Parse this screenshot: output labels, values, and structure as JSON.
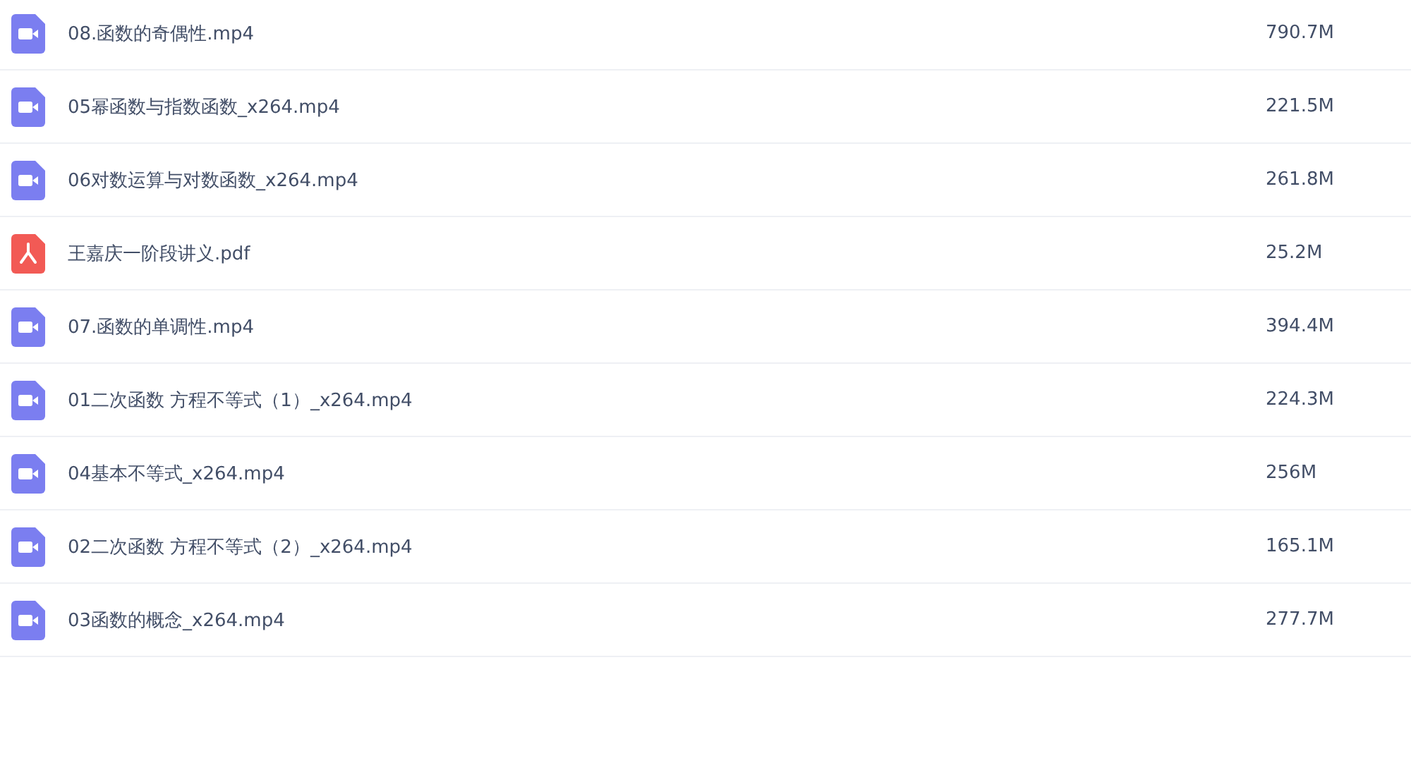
{
  "files": [
    {
      "kind": "video",
      "name": "08.函数的奇偶性.mp4",
      "size": "790.7M"
    },
    {
      "kind": "video",
      "name": "05幂函数与指数函数_x264.mp4",
      "size": "221.5M"
    },
    {
      "kind": "video",
      "name": "06对数运算与对数函数_x264.mp4",
      "size": "261.8M"
    },
    {
      "kind": "pdf",
      "name": "王嘉庆一阶段讲义.pdf",
      "size": "25.2M"
    },
    {
      "kind": "video",
      "name": "07.函数的单调性.mp4",
      "size": "394.4M"
    },
    {
      "kind": "video",
      "name": "01二次函数 方程不等式（1）_x264.mp4",
      "size": "224.3M"
    },
    {
      "kind": "video",
      "name": "04基本不等式_x264.mp4",
      "size": "256M"
    },
    {
      "kind": "video",
      "name": "02二次函数 方程不等式（2）_x264.mp4",
      "size": "165.1M"
    },
    {
      "kind": "video",
      "name": "03函数的概念_x264.mp4",
      "size": "277.7M"
    }
  ]
}
